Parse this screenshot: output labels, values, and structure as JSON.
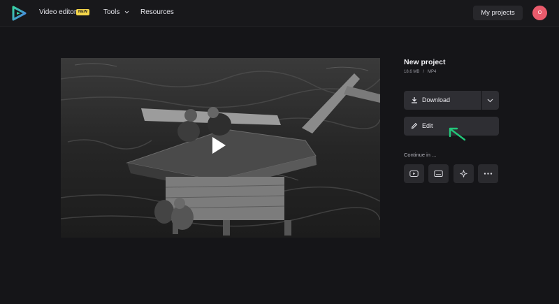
{
  "header": {
    "nav": {
      "video_editor": "Video editor",
      "new_badge": "NEW",
      "tools": "Tools",
      "resources": "Resources"
    },
    "my_projects": "My projects",
    "avatar_initial": "O"
  },
  "project": {
    "title": "New project",
    "size": "18.6 MB",
    "separator": "/",
    "format": "MP4"
  },
  "actions": {
    "download": "Download",
    "edit": "Edit"
  },
  "continue_in": {
    "label": "Continue in ...",
    "icons": [
      "youtube-icon",
      "captions-icon",
      "sparkle-icon",
      "more-icon"
    ]
  },
  "colors": {
    "accent_logo": "#4fb6d6",
    "badge": "#f5d64a",
    "avatar": "#ea5b6c",
    "arrow": "#22c77a"
  }
}
